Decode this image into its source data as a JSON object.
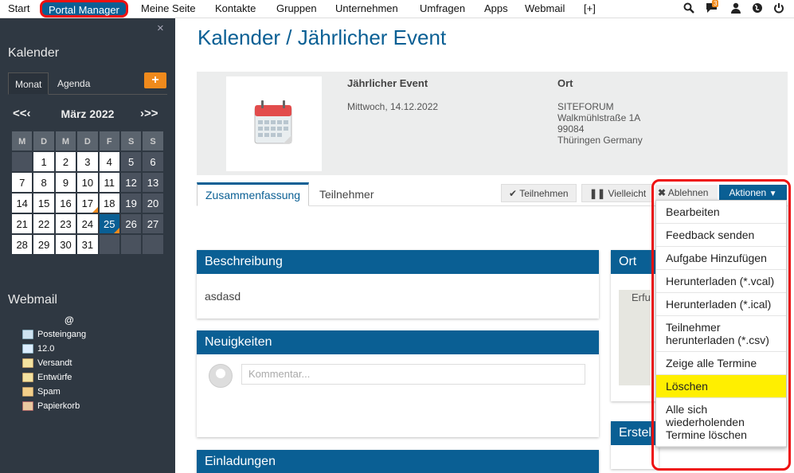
{
  "topnav": {
    "items": [
      "Start",
      "Portal Manager",
      "Meine Seite",
      "Kontakte",
      "Gruppen",
      "Unternehmen",
      "Umfragen",
      "Apps",
      "Webmail",
      "[+]"
    ],
    "active": "Portal Manager",
    "chat_badge": "3",
    "icons": [
      "search-icon",
      "chat-icon",
      "user-icon",
      "globe-icon",
      "power-icon"
    ]
  },
  "sidebar": {
    "close": "×",
    "calendar_title": "Kalender",
    "tabs": [
      "Monat",
      "Agenda"
    ],
    "add": "+",
    "prev": "<<‹",
    "next": "›>>",
    "month": "März 2022",
    "weekdays": [
      "M",
      "D",
      "M",
      "D",
      "F",
      "S",
      "S"
    ],
    "weeks": [
      [
        "",
        "1",
        "2",
        "3",
        "4",
        "5",
        "6"
      ],
      [
        "7",
        "8",
        "9",
        "10",
        "11",
        "12",
        "13"
      ],
      [
        "14",
        "15",
        "16",
        "17",
        "18",
        "19",
        "20"
      ],
      [
        "21",
        "22",
        "23",
        "24",
        "25",
        "26",
        "27"
      ],
      [
        "28",
        "29",
        "30",
        "31",
        "",
        "",
        ""
      ]
    ],
    "today": "25",
    "marked_days": [
      "17",
      "25"
    ],
    "webmail_title": "Webmail",
    "webmail_at": "@",
    "folders": [
      "Posteingang",
      "12.0",
      "Versandt",
      "Entwürfe",
      "Spam",
      "Papierkorb"
    ]
  },
  "main": {
    "title": "Kalender / Jährlicher Event",
    "event_title": "Jährlicher Event",
    "event_date": "Mittwoch, 14.12.2022",
    "ort_label": "Ort",
    "address": [
      "SITEFORUM",
      "Walkmühlstraße 1A",
      "99084",
      "Thüringen Germany"
    ],
    "tabs": [
      "Zusammenfassung",
      "Teilnehmer"
    ],
    "rsvp": {
      "accept": "Teilnehmen",
      "maybe": "Vielleicht",
      "decline": "Ablehnen"
    },
    "actions_label": "Aktionen",
    "panels": {
      "beschreibung": "Beschreibung",
      "beschreibung_text": "asdasd",
      "neuigkeiten": "Neuigkeiten",
      "comment_placeholder": "Kommentar...",
      "einladungen": "Einladungen",
      "ort": "Ort",
      "map_text": "Erfu",
      "ersteller": "Erstel"
    }
  },
  "actions_menu": [
    "Bearbeiten",
    "Feedback senden",
    "Aufgabe Hinzufügen",
    "Herunterladen (*.vcal)",
    "Herunterladen (*.ical)",
    "Teilnehmer herunterladen (*.csv)",
    "Zeige alle Termine",
    "Löschen",
    "Alle sich wiederholenden Termine löschen"
  ],
  "highlighted_action": "Löschen",
  "colors": {
    "brand": "#0a5f94",
    "accent": "#f08a1c",
    "highlight": "#ffef00",
    "annotation": "#e11111"
  }
}
